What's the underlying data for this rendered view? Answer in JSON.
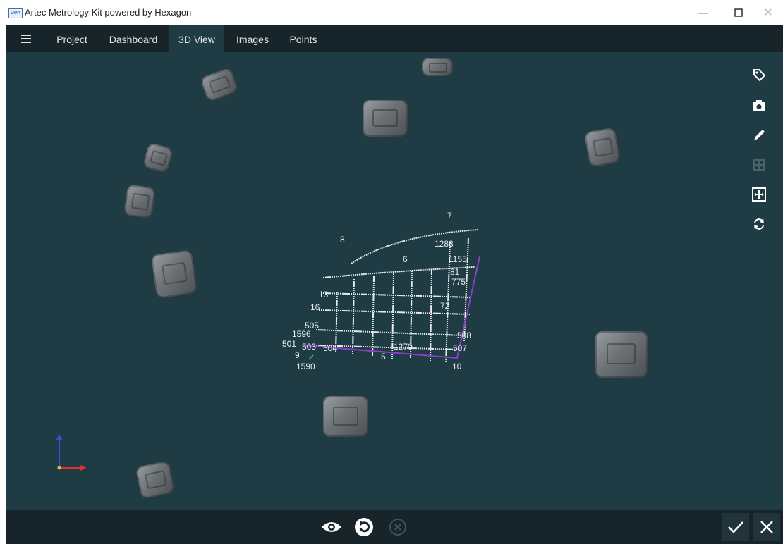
{
  "window": {
    "logo_text": "DPA",
    "title": "Artec Metrology Kit powered by Hexagon"
  },
  "menu": {
    "icon": "hamburger-menu-icon"
  },
  "tabs": [
    {
      "label": "Project"
    },
    {
      "label": "Dashboard"
    },
    {
      "label": "3D View",
      "active": true
    },
    {
      "label": "Images"
    },
    {
      "label": "Points"
    }
  ],
  "toolbar_right": {
    "items": [
      "tag-icon",
      "camera-icon",
      "pencil-icon",
      "grid-disabled-icon",
      "fit-view-icon",
      "rotate-icon"
    ]
  },
  "point_cloud_labels": [
    "7",
    "1288",
    "8",
    "6",
    "1155",
    "81",
    "775",
    "13",
    "16",
    "72",
    "505",
    "1596",
    "501",
    "503",
    "504",
    "9",
    "1590",
    "5",
    "508",
    "507",
    "10",
    "1270"
  ],
  "bottom_toolbar": {
    "items": [
      "eye-icon",
      "refresh-icon",
      "cancel-circle-icon"
    ],
    "confirm_icon": "checkmark-icon",
    "cancel_icon": "close-icon"
  },
  "colors": {
    "viewport_background": "#1f3c44",
    "bar_background": "#17242a",
    "axis_x": "#e03030",
    "axis_z": "#3050e0",
    "outline_purple": "#8a3fd0"
  }
}
